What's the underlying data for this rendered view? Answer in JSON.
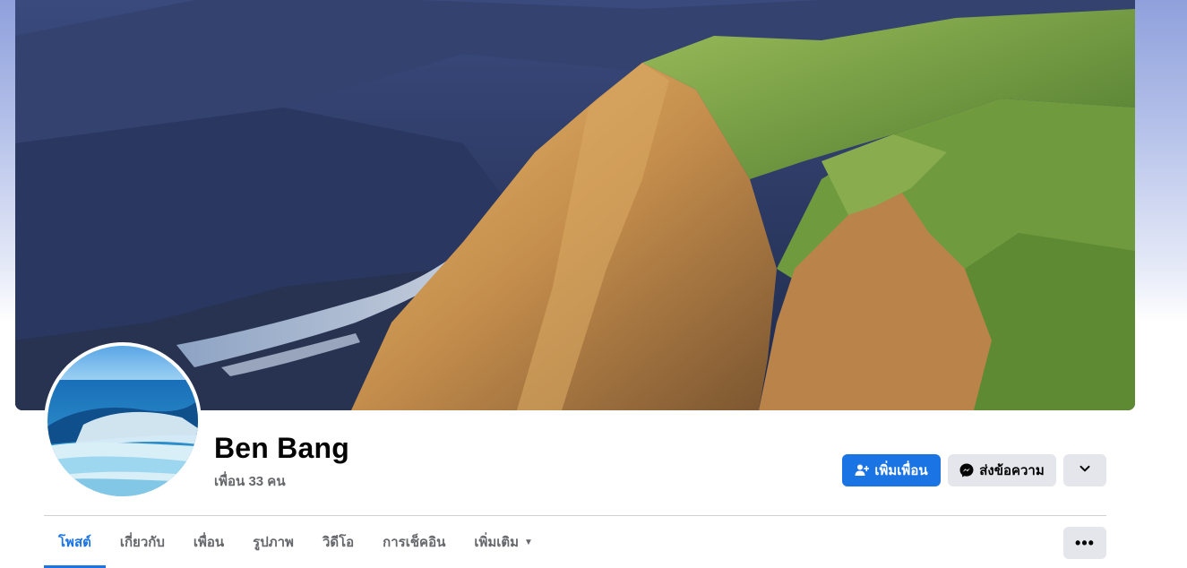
{
  "profile": {
    "name": "Ben Bang",
    "friends_count_label": "เพื่อน 33 คน"
  },
  "actions": {
    "add_friend_label": "เพิ่มเพื่อน",
    "message_label": "ส่งข้อความ"
  },
  "tabs": [
    {
      "label": "โพสต์",
      "active": true
    },
    {
      "label": "เกี่ยวกับ",
      "active": false
    },
    {
      "label": "เพื่อน",
      "active": false
    },
    {
      "label": "รูปภาพ",
      "active": false
    },
    {
      "label": "วิดีโอ",
      "active": false
    },
    {
      "label": "การเช็คอิน",
      "active": false
    },
    {
      "label": "เพิ่มเติม",
      "active": false
    }
  ],
  "icons": {
    "add_friend": "person-add-icon",
    "message": "messenger-icon",
    "more": "chevron-down-icon",
    "tab_more": "caret-down-icon",
    "overflow": "more-horizontal-icon"
  },
  "colors": {
    "accent": "#1b74e4",
    "secondary_button": "#e4e6eb",
    "muted_text": "#65676b",
    "primary_text": "#050505"
  }
}
